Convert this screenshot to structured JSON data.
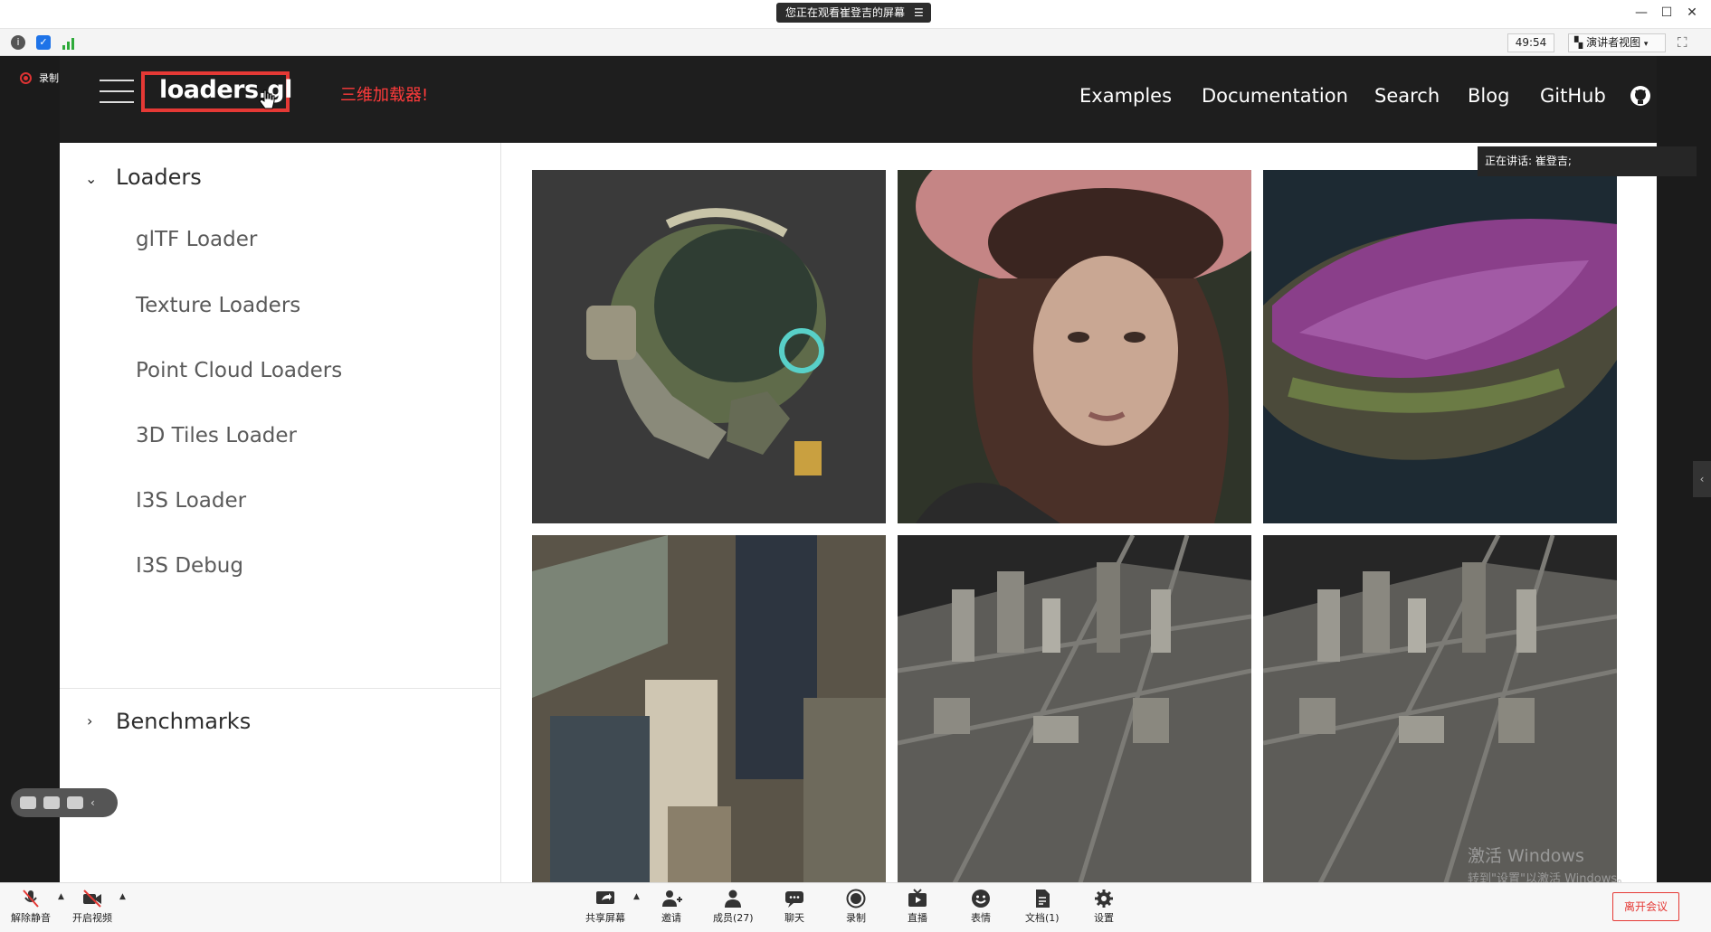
{
  "window": {
    "share_banner": "您正在观看崔登吉的屏幕",
    "minimize": "—",
    "maximize": "☐",
    "close": "✕"
  },
  "infobar": {
    "timer": "49:54",
    "view_mode": "演讲者视图"
  },
  "recording": {
    "label": "录制中"
  },
  "site": {
    "logo": "loaders.gl",
    "annotation": "三维加载器!",
    "nav": [
      "Examples",
      "Documentation",
      "Search",
      "Blog",
      "GitHub"
    ],
    "sidebar": {
      "section1": "Loaders",
      "items": [
        "glTF Loader",
        "Texture Loaders",
        "Point Cloud Loaders",
        "3D Tiles Loader",
        "I3S Loader",
        "I3S Debug"
      ],
      "section2": "Benchmarks"
    }
  },
  "speaking": {
    "label": "正在讲话: 崔登吉;"
  },
  "watermark": {
    "line1": "激活 Windows",
    "line2": "转到\"设置\"以激活 Windows。"
  },
  "toolbar": {
    "unmute": "解除静音",
    "start_video": "开启视频",
    "share_screen": "共享屏幕",
    "invite": "邀请",
    "members": "成员(27)",
    "chat": "聊天",
    "record": "录制",
    "live": "直播",
    "reactions": "表情",
    "docs": "文档(1)",
    "settings": "设置",
    "leave": "离开会议"
  }
}
